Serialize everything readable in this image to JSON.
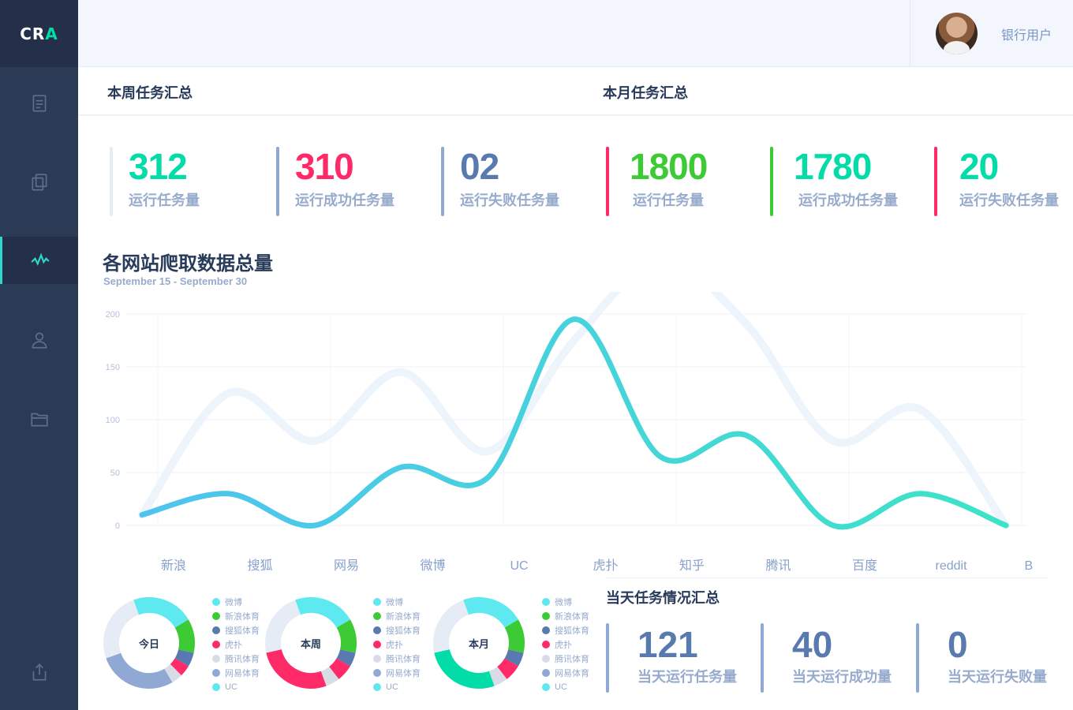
{
  "logo": {
    "prefix": "CR",
    "accent": "A"
  },
  "user": {
    "name": "银行用户"
  },
  "sidebar": {
    "items": [
      {
        "icon": "document-icon"
      },
      {
        "icon": "copy-icon"
      },
      {
        "icon": "activity-icon",
        "active": true
      },
      {
        "icon": "user-icon"
      },
      {
        "icon": "folder-icon"
      },
      {
        "icon": "export-icon"
      }
    ]
  },
  "week": {
    "title": "本周任务汇总",
    "stats": [
      {
        "value": "312",
        "label": "运行任务量",
        "color": "#02dca8",
        "bar": "#e6ecf5"
      },
      {
        "value": "310",
        "label": "运行成功任务量",
        "color": "#ff2a68",
        "bar": "#8fa8d4"
      },
      {
        "value": "02",
        "label": "运行失败任务量",
        "color": "#597aaf",
        "bar": "#8fa8d4"
      }
    ]
  },
  "month": {
    "title": "本月任务汇总",
    "stats": [
      {
        "value": "1800",
        "label": "运行任务量",
        "color": "#3dcb35",
        "bar": "#ff2a68"
      },
      {
        "value": "1780",
        "label": "运行成功任务量",
        "color": "#02dca8",
        "bar": "#3dcb35"
      },
      {
        "value": "20",
        "label": "运行失败任务量",
        "color": "#02dca8",
        "bar": "#ff2a68"
      }
    ]
  },
  "chart_data": {
    "type": "line",
    "title": "各网站爬取数据总量",
    "subtitle": "September 15 - September 30",
    "categories": [
      "新浪",
      "搜狐",
      "网易",
      "微博",
      "UC",
      "虎扑",
      "知乎",
      "腾讯",
      "百度",
      "reddit",
      "BBC"
    ],
    "ylim": [
      0,
      200
    ],
    "yticks": [
      0,
      50,
      100,
      150,
      200
    ],
    "grid": true,
    "series": [
      {
        "values": [
          10,
          30,
          0,
          55,
          45,
          195,
          65,
          85,
          0,
          30,
          0
        ],
        "color": "#3ac8e0"
      },
      {
        "values": [
          10,
          125,
          80,
          145,
          70,
          175,
          250,
          190,
          80,
          110,
          0
        ],
        "color": "#eef4fc"
      }
    ]
  },
  "donuts": [
    {
      "label": "今日",
      "segments": [
        {
          "name": "微博",
          "value": 22,
          "color": "#5de9ef"
        },
        {
          "name": "新浪体育",
          "value": 12,
          "color": "#3dcb35"
        },
        {
          "name": "搜狐体育",
          "value": 5,
          "color": "#597aaf"
        },
        {
          "name": "虎扑",
          "value": 4,
          "color": "#ff2a68"
        },
        {
          "name": "腾讯体育",
          "value": 4,
          "color": "#d7dce6"
        },
        {
          "name": "网易体育",
          "value": 28,
          "color": "#8fa8d4"
        },
        {
          "name": "UC",
          "value": 25,
          "color": "#e6ecf5"
        }
      ]
    },
    {
      "label": "本周",
      "segments": [
        {
          "name": "微博",
          "value": 22,
          "color": "#5de9ef"
        },
        {
          "name": "新浪体育",
          "value": 12,
          "color": "#3dcb35"
        },
        {
          "name": "搜狐体育",
          "value": 5,
          "color": "#597aaf"
        },
        {
          "name": "虎扑",
          "value": 6,
          "color": "#ff2a68"
        },
        {
          "name": "腾讯体育",
          "value": 5,
          "color": "#d7dce6"
        },
        {
          "name": "网易体育",
          "value": 27,
          "color": "#ff2a68"
        },
        {
          "name": "UC",
          "value": 23,
          "color": "#e6ecf5"
        }
      ]
    },
    {
      "label": "本月",
      "segments": [
        {
          "name": "微博",
          "value": 22,
          "color": "#5de9ef"
        },
        {
          "name": "新浪体育",
          "value": 12,
          "color": "#3dcb35"
        },
        {
          "name": "搜狐体育",
          "value": 5,
          "color": "#597aaf"
        },
        {
          "name": "虎扑",
          "value": 6,
          "color": "#ff2a68"
        },
        {
          "name": "腾讯体育",
          "value": 5,
          "color": "#d7dce6"
        },
        {
          "name": "网易体育",
          "value": 27,
          "color": "#02dca8"
        },
        {
          "name": "UC",
          "value": 23,
          "color": "#e6ecf5"
        }
      ]
    }
  ],
  "legend": [
    {
      "name": "微博",
      "color": "#5de9ef"
    },
    {
      "name": "新浪体育",
      "color": "#3dcb35"
    },
    {
      "name": "搜狐体育",
      "color": "#597aaf"
    },
    {
      "name": "虎扑",
      "color": "#ff2a68"
    },
    {
      "name": "腾讯体育",
      "color": "#d7dce6"
    },
    {
      "name": "网易体育",
      "color": "#8fa8d4"
    },
    {
      "name": "UC",
      "color": "#5de9ef"
    }
  ],
  "today": {
    "title": "当天任务情况汇总",
    "stats": [
      {
        "value": "121",
        "label": "当天运行任务量"
      },
      {
        "value": "40",
        "label": "当天运行成功量"
      },
      {
        "value": "0",
        "label": "当天运行失败量"
      }
    ]
  }
}
